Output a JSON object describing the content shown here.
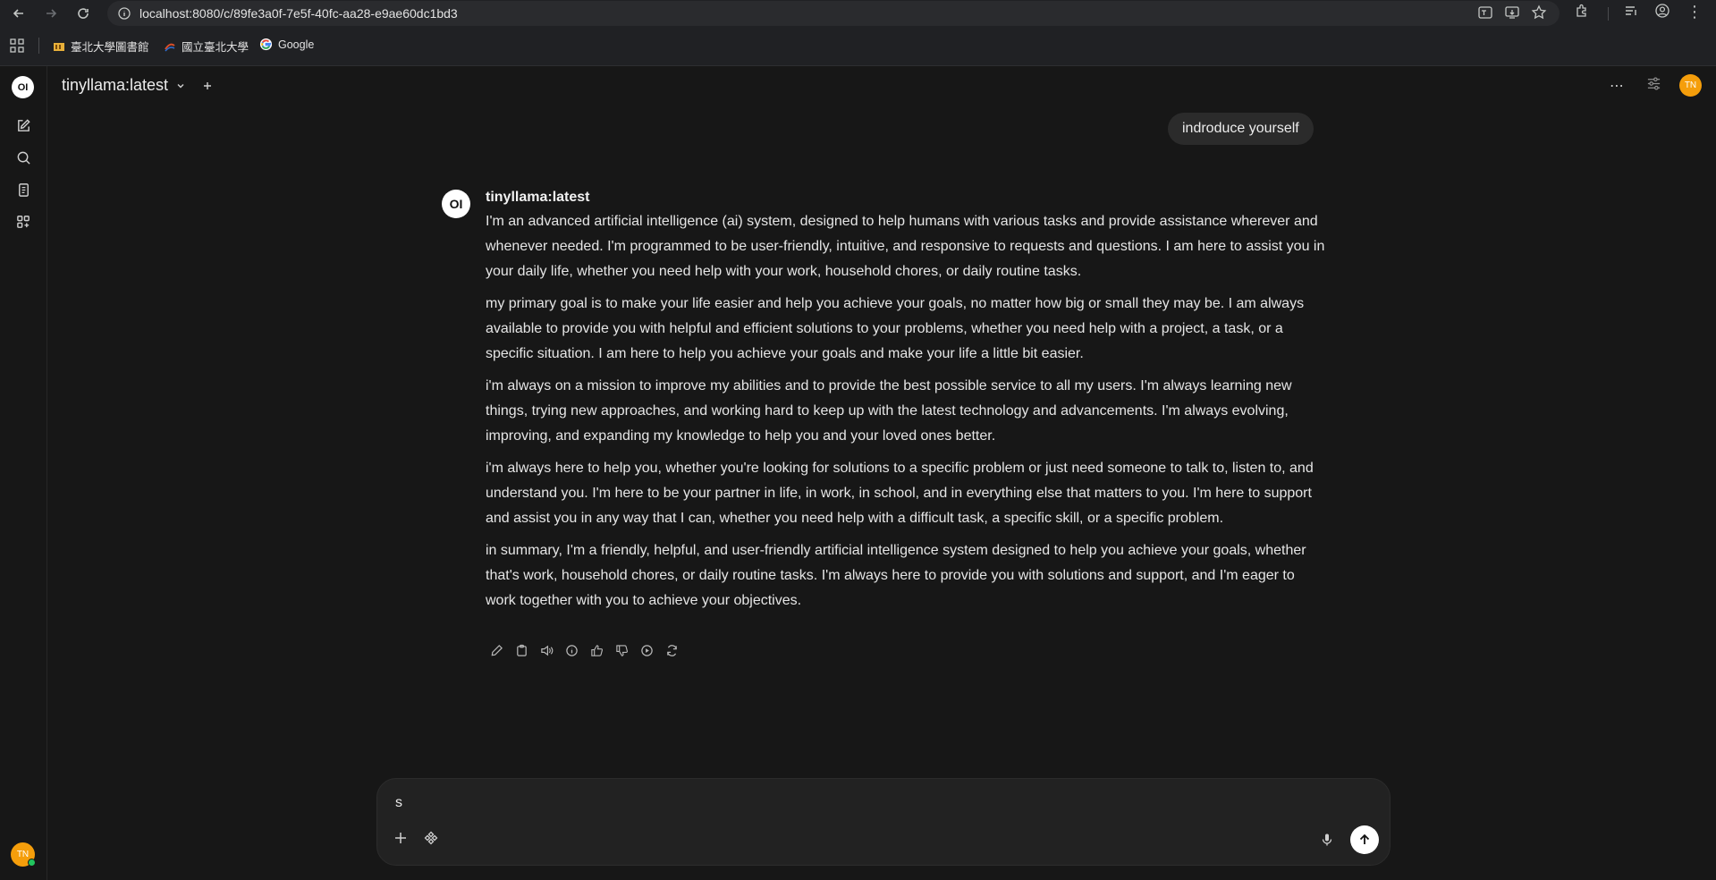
{
  "browser": {
    "url": "localhost:8080/c/89fe3a0f-7e5f-40fc-aa28-e9ae60dc1bd3",
    "bookmarks": [
      {
        "label": "臺北大學圖書館",
        "icon": "library-favicon"
      },
      {
        "label": "國立臺北大學",
        "icon": "university-favicon"
      },
      {
        "label": "Google",
        "icon": "google-favicon"
      }
    ]
  },
  "sidebar": {
    "logo": "OI",
    "items": [
      {
        "name": "new-chat",
        "icon": "pencil-square-icon"
      },
      {
        "name": "search",
        "icon": "search-icon"
      },
      {
        "name": "notes",
        "icon": "notes-icon"
      },
      {
        "name": "workspace",
        "icon": "grid-plus-icon"
      }
    ],
    "user_initials": "TN"
  },
  "header": {
    "model": "tinyllama:latest",
    "user_initials": "TN"
  },
  "conversation": {
    "user_message": "indroduce yourself",
    "assistant": {
      "avatar": "OI",
      "name": "tinyllama:latest",
      "paragraphs": [
        "I'm an advanced artificial intelligence (ai) system, designed to help humans with various tasks and provide assistance wherever and whenever needed. I'm programmed to be user-friendly, intuitive, and responsive to requests and questions. I am here to assist you in your daily life, whether you need help with your work, household chores, or daily routine tasks.",
        "my primary goal is to make your life easier and help you achieve your goals, no matter how big or small they may be. I am always available to provide you with helpful and efficient solutions to your problems, whether you need help with a project, a task, or a specific situation. I am here to help you achieve your goals and make your life a little bit easier.",
        "i'm always on a mission to improve my abilities and to provide the best possible service to all my users. I'm always learning new things, trying new approaches, and working hard to keep up with the latest technology and advancements. I'm always evolving, improving, and expanding my knowledge to help you and your loved ones better.",
        "i'm always here to help you, whether you're looking for solutions to a specific problem or just need someone to talk to, listen to, and understand you. I'm here to be your partner in life, in work, in school, and in everything else that matters to you. I'm here to support and assist you in any way that I can, whether you need help with a difficult task, a specific skill, or a specific problem.",
        "in summary, I'm a friendly, helpful, and user-friendly artificial intelligence system designed to help you achieve your goals, whether that's work, household chores, or daily routine tasks. I'm always here to provide you with solutions and support, and I'm eager to work together with you to achieve your objectives."
      ]
    }
  },
  "composer": {
    "value": "s"
  },
  "colors": {
    "background": "#171717",
    "bubble": "#2b2b2b",
    "avatar_accent": "#f59e0b",
    "online": "#22c55e"
  }
}
